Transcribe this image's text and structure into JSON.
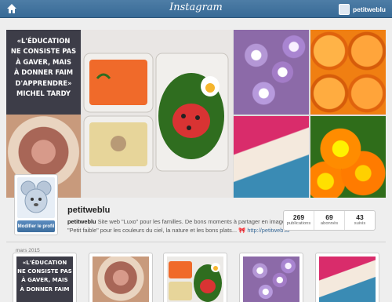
{
  "topbar": {
    "brand": "Instagram",
    "username": "petitweblu",
    "home_icon": "home-icon",
    "colors": {
      "bar": "#386a96"
    }
  },
  "banner": {
    "quote_lines": [
      "«L'ÉDUCATION",
      "NE CONSISTE PAS",
      "À GAVER, MAIS",
      "À DONNER FAIM",
      "D'APPRENDRE»",
      "MICHEL TARDY"
    ]
  },
  "profile": {
    "edit_button": "Modifier le profil",
    "username": "petitweblu",
    "bio_line1_rest": " Site web \"Luxo\" pour les familles. De bons moments à partager en images!",
    "bio_line2": "\"Petit faible\" pour les couleurs du ciel, la nature et les bons plats... 🎀 ",
    "link": "http://petitweb.lu"
  },
  "stats": [
    {
      "number": "269",
      "label": "publications"
    },
    {
      "number": "69",
      "label": "abonnés"
    },
    {
      "number": "43",
      "label": "suivis"
    }
  ],
  "feed": {
    "month_label": "mars 2015",
    "thumb_quote_lines": [
      "«L'ÉDUCATION",
      "NE CONSISTE PAS",
      "À GAVER, MAIS",
      "À DONNER FAIM"
    ]
  }
}
